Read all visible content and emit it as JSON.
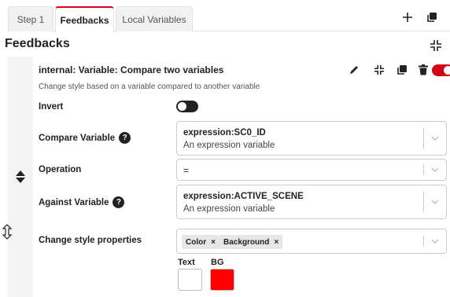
{
  "tabs": [
    {
      "label": "Step 1"
    },
    {
      "label": "Feedbacks"
    },
    {
      "label": "Local Variables"
    }
  ],
  "toolbar": {
    "add_icon": "plus-icon",
    "duplicate_icon": "copy-icon"
  },
  "section": {
    "title": "Feedbacks"
  },
  "feedback": {
    "title": "internal: Variable: Compare two variables",
    "description": "Change style based on a variable compared to another variable",
    "enabled": true,
    "actions": [
      "pencil-icon",
      "collapse-icon",
      "copy-icon",
      "trash-icon",
      "toggle-on"
    ]
  },
  "fields": {
    "invert": {
      "label": "Invert",
      "value": false
    },
    "compare": {
      "label": "Compare Variable",
      "value": "expression:SC0_ID",
      "sub": "An expression variable",
      "help": "?"
    },
    "operation": {
      "label": "Operation",
      "value": "="
    },
    "against": {
      "label": "Against Variable",
      "value": "expression:ACTIVE_SCENE",
      "sub": "An expression variable",
      "help": "?"
    },
    "style": {
      "label": "Change style properties",
      "chips": [
        "Color",
        "Background"
      ],
      "chip_remove": "×"
    }
  },
  "colors": {
    "text_label": "Text",
    "bg_label": "BG",
    "text_color": "#ffffff",
    "bg_color": "#ff0000",
    "accent": "#d50215"
  }
}
